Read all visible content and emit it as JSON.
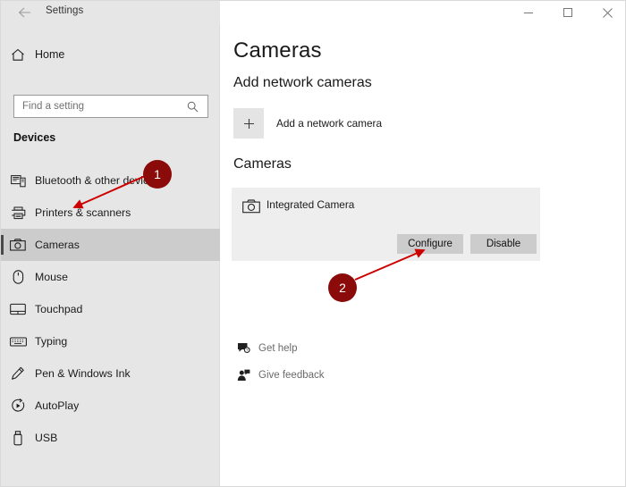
{
  "titlebar": {
    "back_icon": "back-arrow-icon",
    "title": "Settings",
    "minimize_label": "–",
    "maximize_label": "□",
    "close_label": "✕"
  },
  "sidebar": {
    "home": {
      "label": "Home",
      "icon": "home-icon"
    },
    "search": {
      "value": "",
      "placeholder": "Find a setting",
      "icon": "search-icon"
    },
    "section_title": "Devices",
    "items": [
      {
        "label": "Bluetooth & other devices",
        "icon": "bluetooth-devices-icon",
        "selected": false
      },
      {
        "label": "Printers & scanners",
        "icon": "printer-icon",
        "selected": false
      },
      {
        "label": "Cameras",
        "icon": "camera-icon",
        "selected": true
      },
      {
        "label": "Mouse",
        "icon": "mouse-icon",
        "selected": false
      },
      {
        "label": "Touchpad",
        "icon": "touchpad-icon",
        "selected": false
      },
      {
        "label": "Typing",
        "icon": "keyboard-icon",
        "selected": false
      },
      {
        "label": "Pen & Windows Ink",
        "icon": "pen-icon",
        "selected": false
      },
      {
        "label": "AutoPlay",
        "icon": "autoplay-icon",
        "selected": false
      },
      {
        "label": "USB",
        "icon": "usb-icon",
        "selected": false
      }
    ]
  },
  "main": {
    "page_title": "Cameras",
    "add_network_heading": "Add network cameras",
    "add_camera_button": {
      "label": "Add a network camera",
      "icon": "plus-icon"
    },
    "cameras_heading": "Cameras",
    "camera_card": {
      "icon": "camera-icon",
      "name": "Integrated Camera",
      "configure_label": "Configure",
      "disable_label": "Disable"
    },
    "help_links": [
      {
        "label": "Get help",
        "icon": "get-help-icon"
      },
      {
        "label": "Give feedback",
        "icon": "give-feedback-icon"
      }
    ]
  },
  "annotations": {
    "color": "#cc0000",
    "marker_color": "#8b0a0a",
    "markers": [
      {
        "label": "1",
        "points_to": "sidebar-item-cameras"
      },
      {
        "label": "2",
        "points_to": "configure-button"
      }
    ]
  }
}
